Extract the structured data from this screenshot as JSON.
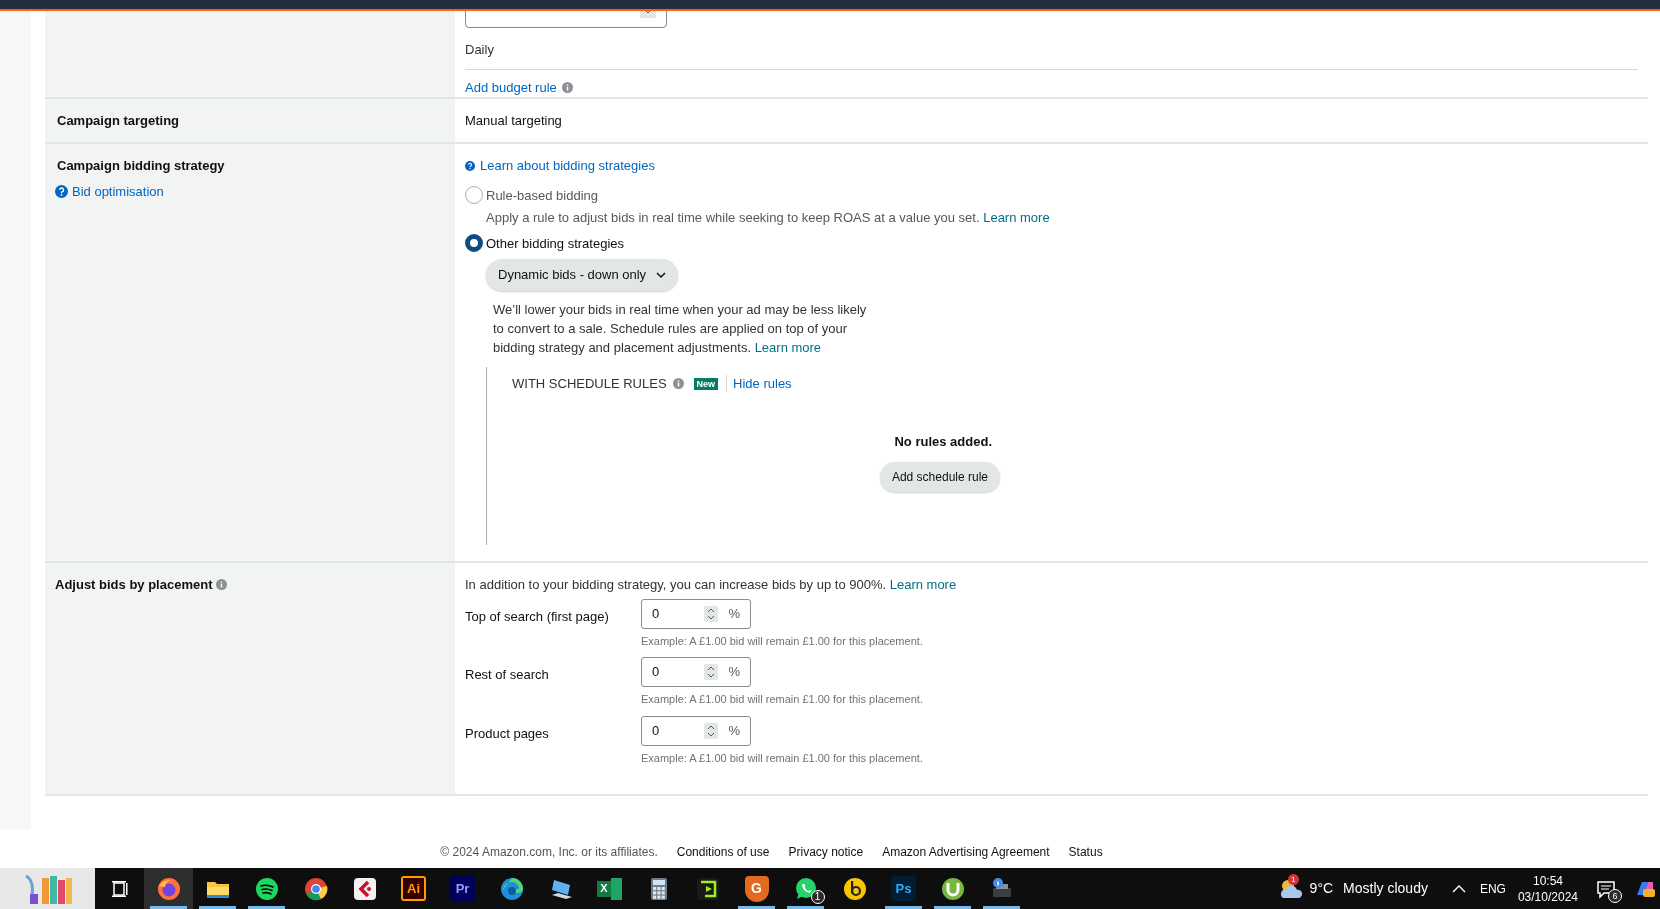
{
  "budget": {
    "period": "Daily",
    "rule_link": "Add budget rule"
  },
  "targeting": {
    "label": "Campaign targeting",
    "value": "Manual targeting"
  },
  "bidding": {
    "label": "Campaign bidding strategy",
    "help_link": "Bid optimisation",
    "learn_link": "Learn about bidding strategies",
    "options": [
      {
        "label": "Rule-based bidding",
        "selected": false,
        "description": "Apply a rule to adjust bids in real time while seeking to keep ROAS at a value you set.",
        "link": "Learn more"
      },
      {
        "label": "Other bidding strategies",
        "selected": true
      }
    ],
    "strategy": "Dynamic bids - down only",
    "strategy_description": "We’ll lower your bids in real time when your ad may be less likely to convert to a sale. Schedule rules are applied on top of your bidding strategy and placement adjustments.",
    "strategy_link": "Learn more",
    "schedule": {
      "title": "WITH SCHEDULE RULES",
      "badge": "New",
      "toggle": "Hide rules",
      "empty": "No rules added.",
      "add_button": "Add schedule rule"
    }
  },
  "placement": {
    "label": "Adjust bids by placement",
    "intro": "In addition to your bidding strategy, you can increase bids by up to 900%.",
    "intro_link": "Learn more",
    "rows": [
      {
        "label": "Top of search (first page)",
        "value": "0",
        "unit": "%",
        "example": "Example: A £1.00 bid will remain £1.00 for this placement."
      },
      {
        "label": "Rest of search",
        "value": "0",
        "unit": "%",
        "example": "Example: A £1.00 bid will remain £1.00 for this placement."
      },
      {
        "label": "Product pages",
        "value": "0",
        "unit": "%",
        "example": "Example: A £1.00 bid will remain £1.00 for this placement."
      }
    ]
  },
  "footer": {
    "copyright": "© 2024 Amazon.com, Inc. or its affiliates.",
    "links": [
      "Conditions of use",
      "Privacy notice",
      "Amazon Advertising Agreement",
      "Status"
    ]
  },
  "taskbar": {
    "apps": [
      {
        "kind": "taskview",
        "running": false,
        "selected": false
      },
      {
        "kind": "fox",
        "running": true,
        "selected": true
      },
      {
        "kind": "folder",
        "running": true,
        "selected": false
      },
      {
        "kind": "spotify",
        "running": true,
        "selected": false
      },
      {
        "kind": "chrome",
        "running": false,
        "selected": false
      },
      {
        "kind": "redapp",
        "running": false,
        "selected": false
      },
      {
        "kind": "ai",
        "label": "Ai",
        "running": false,
        "selected": false
      },
      {
        "kind": "pr",
        "label": "Pr",
        "running": false,
        "selected": false
      },
      {
        "kind": "edge",
        "running": false,
        "selected": false
      },
      {
        "kind": "computer",
        "running": false,
        "selected": false
      },
      {
        "kind": "excel",
        "label": "X",
        "running": false,
        "selected": false
      },
      {
        "kind": "calculator",
        "running": false,
        "selected": false
      },
      {
        "kind": "greenapp",
        "running": false,
        "selected": false
      },
      {
        "kind": "gapp",
        "label": "G",
        "running": true,
        "selected": false
      },
      {
        "kind": "whatsapp",
        "badge": "1",
        "running": true,
        "selected": false
      },
      {
        "kind": "bapp",
        "running": false,
        "selected": false
      },
      {
        "kind": "ps",
        "label": "Ps",
        "running": true,
        "selected": false
      },
      {
        "kind": "torrent",
        "running": true,
        "selected": false
      },
      {
        "kind": "printer",
        "running": true,
        "selected": false
      }
    ],
    "weather": {
      "badge": "1",
      "temperature": "9°C",
      "condition": "Mostly cloudy"
    },
    "language": "ENG",
    "time": "10:54",
    "date": "03/10/2024",
    "notifications": "6"
  }
}
